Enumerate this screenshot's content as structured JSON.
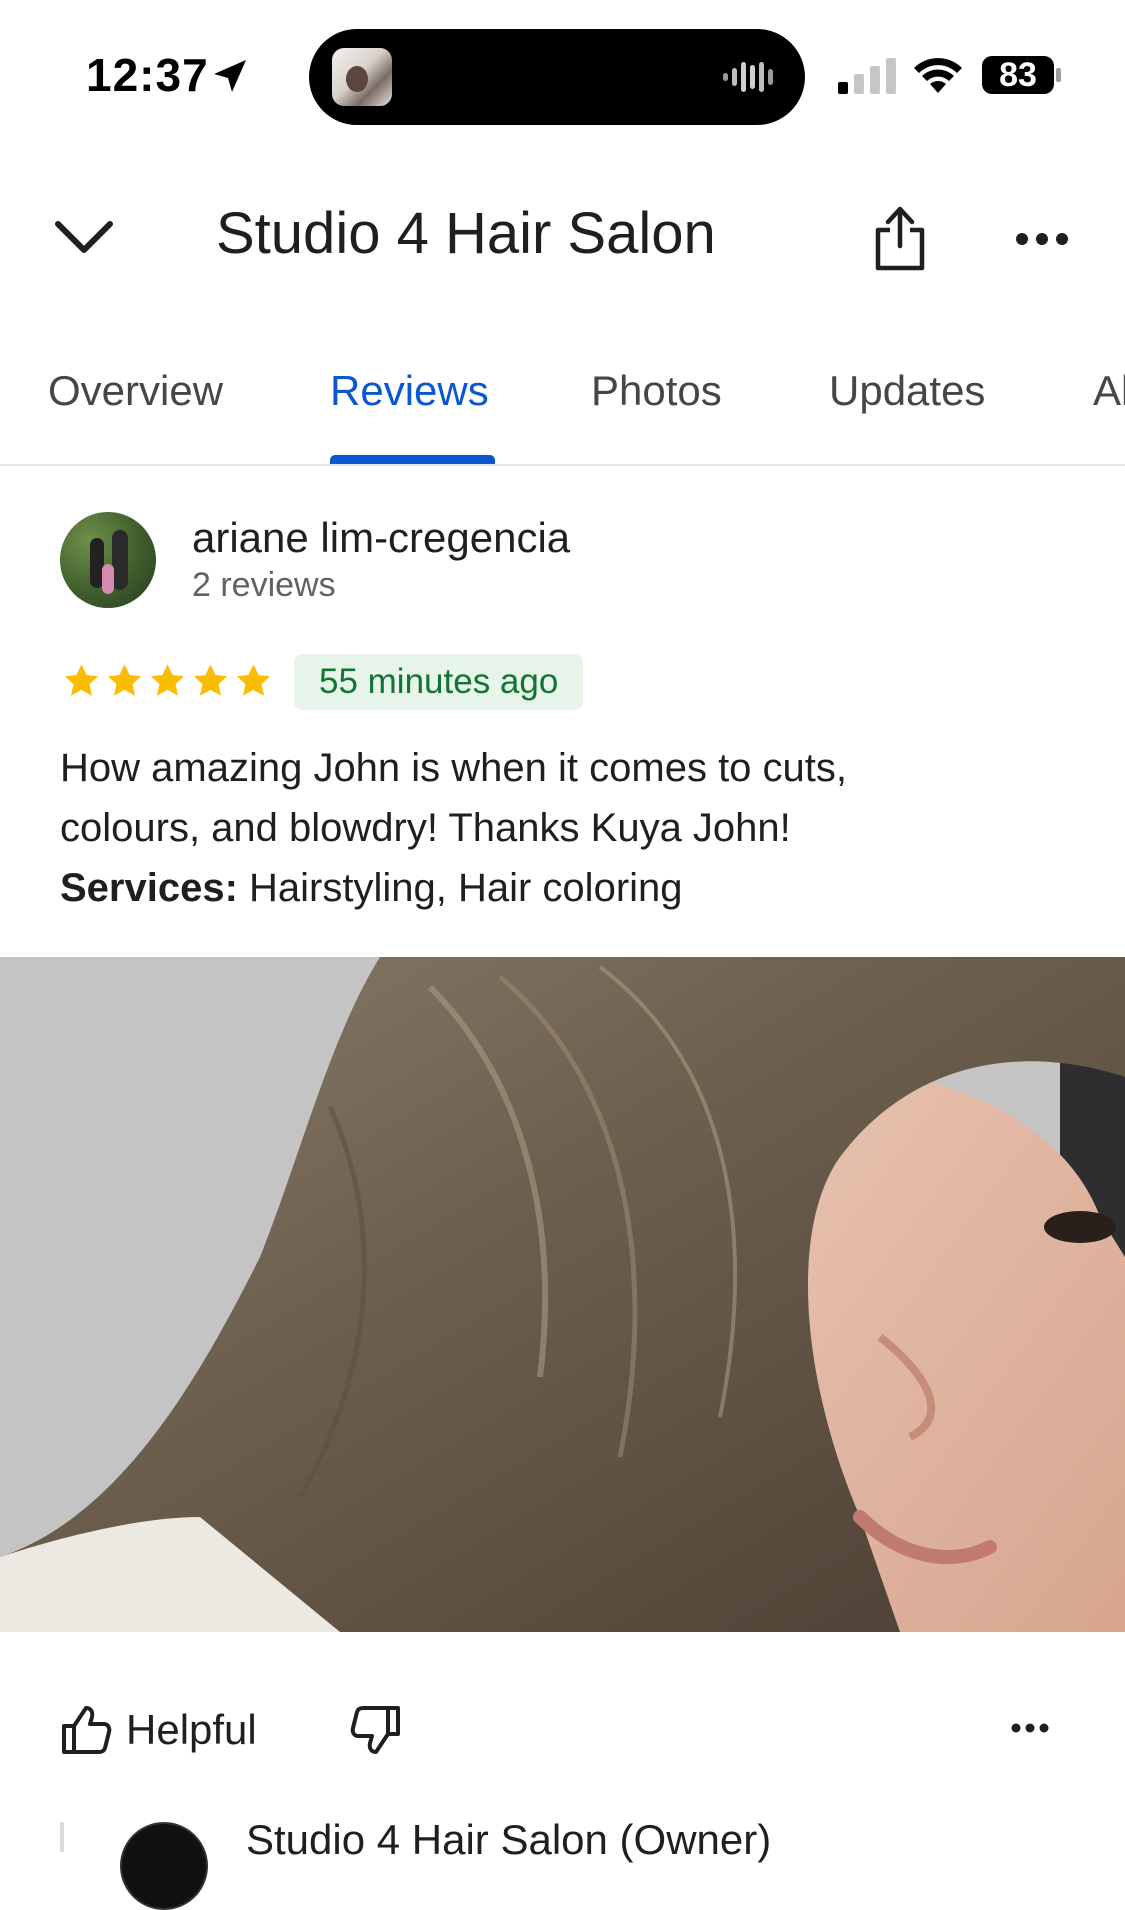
{
  "status_bar": {
    "time": "12:37",
    "battery": "83",
    "icons": [
      "location-arrow-icon",
      "audio-wave-icon",
      "cellular-signal-icon",
      "wifi-icon",
      "battery-icon"
    ]
  },
  "header": {
    "title": "Studio 4 Hair Salon",
    "icons": [
      "chevron-down-icon",
      "share-icon",
      "more-icon"
    ]
  },
  "tabs": [
    {
      "label": "Overview",
      "active": false
    },
    {
      "label": "Reviews",
      "active": true
    },
    {
      "label": "Photos",
      "active": false
    },
    {
      "label": "Updates",
      "active": false
    },
    {
      "label": "Al",
      "active": false
    }
  ],
  "review": {
    "author": "ariane lim-cregencia",
    "author_reviews": "2 reviews",
    "rating": 5,
    "time_ago": "55 minutes ago",
    "text_line1": "How amazing John is when it comes to cuts,",
    "text_line2": "colours, and blowdry! Thanks Kuya John!",
    "services_label": "Services:",
    "services_value": " Hairstyling, Hair coloring"
  },
  "actions": {
    "helpful_label": "Helpful"
  },
  "owner_reply": {
    "name": "Studio 4 Hair Salon (Owner)"
  },
  "colors": {
    "accent": "#0b57d0",
    "star": "#fbbc04",
    "badge_bg": "#e6f4ea",
    "badge_text": "#137333"
  }
}
